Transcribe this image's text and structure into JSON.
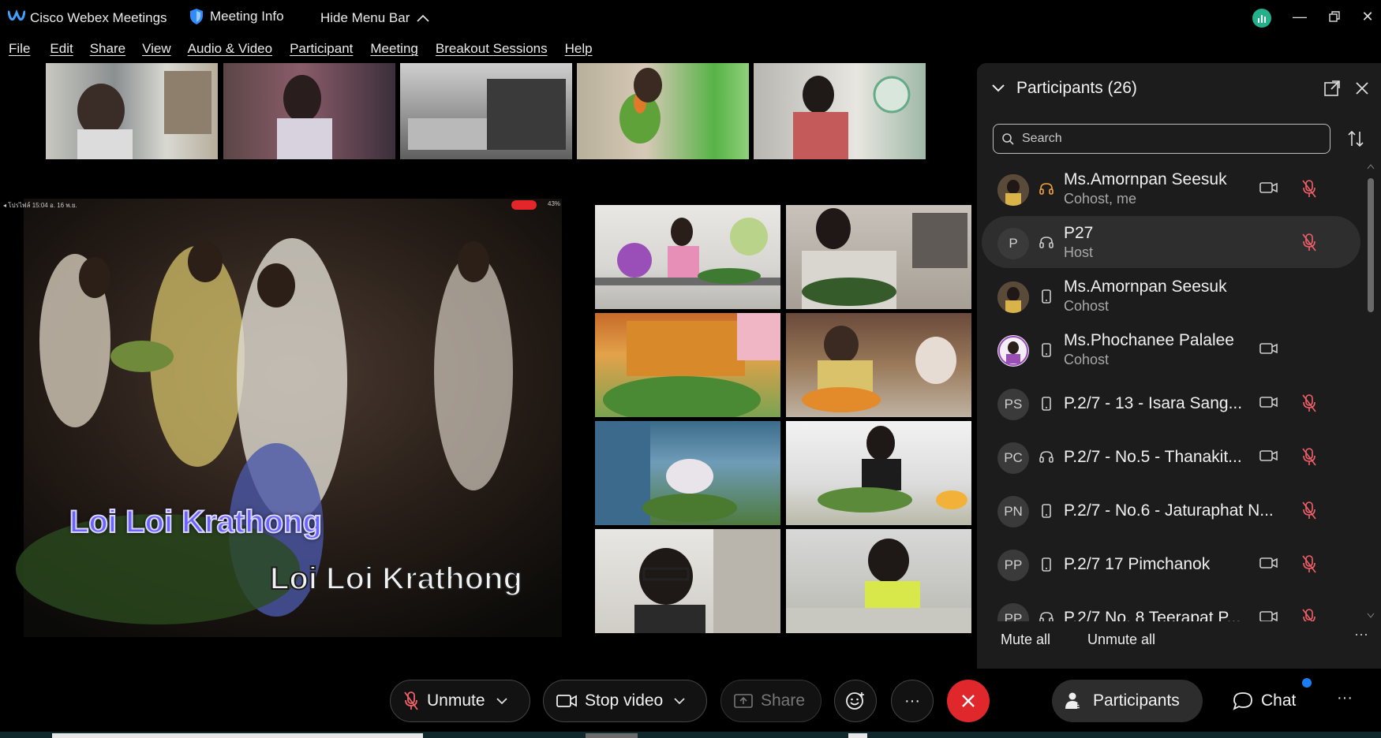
{
  "titlebar": {
    "app_title": "Cisco Webex Meetings",
    "meeting_info": "Meeting Info",
    "hide_menu": "Hide Menu Bar"
  },
  "menu": [
    "File",
    "Edit",
    "Share",
    "View",
    "Audio & Video",
    "Participant",
    "Meeting",
    "Breakout Sessions",
    "Help"
  ],
  "shared_video": {
    "phone_status": "◂ โปรไฟล์  15:04  อ. 16 พ.ย.",
    "battery": "43%",
    "caption_line1": "Loi Loi Krathong",
    "caption_line2": "Loi Loi Krathong"
  },
  "panel": {
    "title": "Participants (26)",
    "search_placeholder": "Search",
    "participants": [
      {
        "initials": "",
        "name": "Ms.Amornpan Seesuk",
        "role": "Cohost, me",
        "device": "headset",
        "camera": true,
        "muted": true
      },
      {
        "initials": "P",
        "name": "P27",
        "role": "Host",
        "device": "headset",
        "camera": false,
        "muted": true
      },
      {
        "initials": "",
        "name": "Ms.Amornpan Seesuk",
        "role": "Cohost",
        "device": "mobile",
        "camera": false,
        "muted": false
      },
      {
        "initials": "",
        "name": "Ms.Phochanee Palalee",
        "role": "Cohost",
        "device": "mobile",
        "camera": true,
        "muted": false
      },
      {
        "initials": "PS",
        "name": "P.2/7 - 13 - Isara Sang...",
        "role": "",
        "device": "mobile",
        "camera": true,
        "muted": true
      },
      {
        "initials": "PC",
        "name": "P.2/7 - No.5 - Thanakit...",
        "role": "",
        "device": "headset",
        "camera": true,
        "muted": true
      },
      {
        "initials": "PN",
        "name": "P.2/7 - No.6 - Jaturaphat N...",
        "role": "",
        "device": "mobile",
        "camera": false,
        "muted": true
      },
      {
        "initials": "PP",
        "name": "P.2/7 17 Pimchanok",
        "role": "",
        "device": "mobile",
        "camera": true,
        "muted": true
      },
      {
        "initials": "PP",
        "name": "P.2/7 No. 8 Teerapat P...",
        "role": "",
        "device": "headset",
        "camera": true,
        "muted": true
      }
    ],
    "mute_all": "Mute all",
    "unmute_all": "Unmute all",
    "more": "···"
  },
  "toolbar": {
    "unmute": "Unmute",
    "stop_video": "Stop video",
    "share": "Share",
    "more": "···",
    "participants": "Participants",
    "chat": "Chat",
    "overflow": "···"
  },
  "colors": {
    "panel_bg": "#1c1c1c",
    "selected_row": "#2e2e2e",
    "muted_red": "#f0606a",
    "leave_red": "#e0272b",
    "chat_badge": "#1c7cf2",
    "stats_green": "#23b08a"
  }
}
